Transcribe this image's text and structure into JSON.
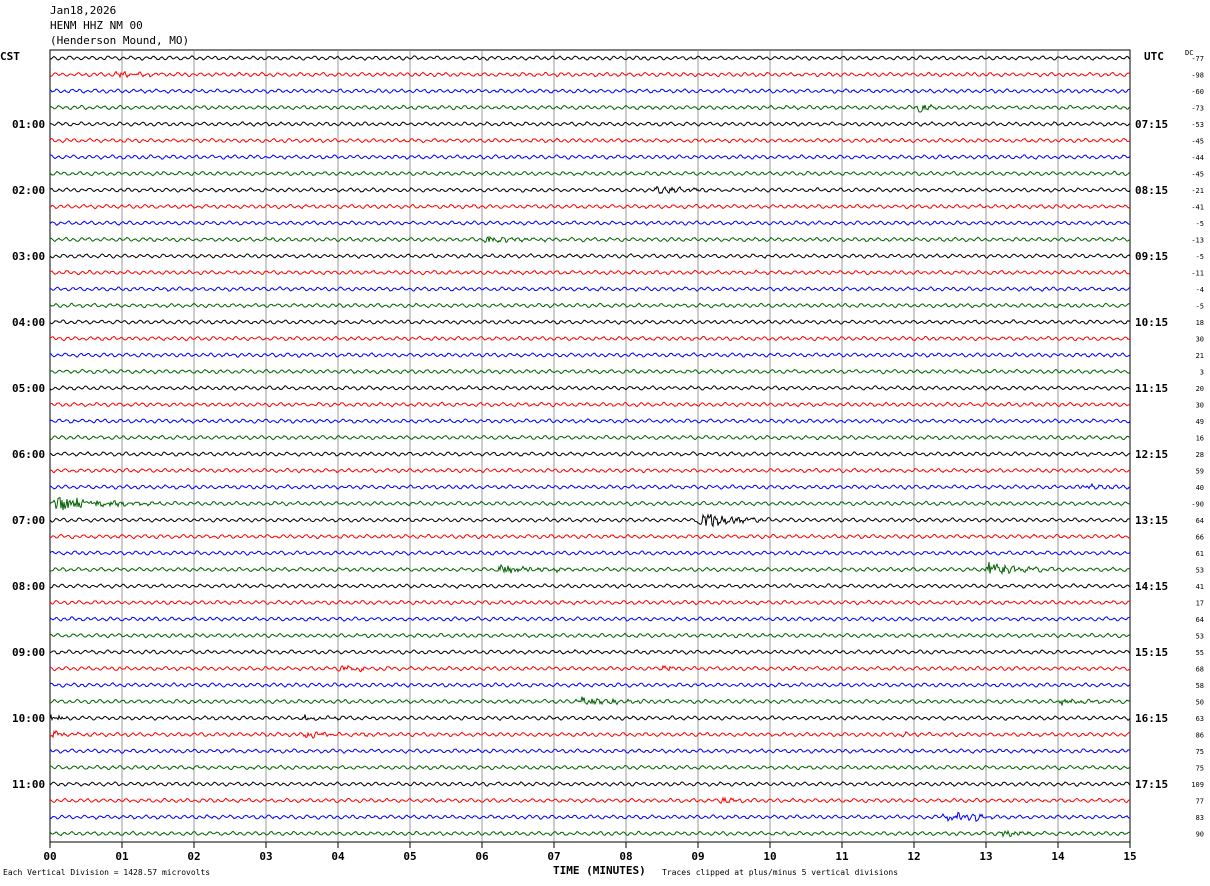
{
  "header": {
    "date": "Jan18,2026",
    "station": "HENM HHZ NM 00",
    "location": "(Henderson Mound, MO)"
  },
  "axes": {
    "left_label": "CST",
    "right_label": "UTC",
    "dc_label": "DC",
    "xlabel": "TIME (MINUTES)"
  },
  "footer": {
    "scale_note": "Each Vertical Division = 1428.57 microvolts",
    "clip_note": "Traces clipped at plus/minus 5 vertical divisions"
  },
  "colors": {
    "black": "#000000",
    "red": "#ff0000",
    "blue": "#0000ff",
    "green": "#006400",
    "grid": "#808080"
  },
  "chart_data": {
    "type": "line",
    "title": "",
    "x_ticks": [
      "00",
      "01",
      "02",
      "03",
      "04",
      "05",
      "06",
      "07",
      "08",
      "09",
      "10",
      "11",
      "12",
      "13",
      "14",
      "15"
    ],
    "xlim": [
      0,
      15
    ],
    "line_count": 48,
    "trace_color_cycle": [
      "black",
      "red",
      "blue",
      "green"
    ],
    "left_hour_labels": [
      {
        "line": 4,
        "label": "01:00"
      },
      {
        "line": 8,
        "label": "02:00"
      },
      {
        "line": 12,
        "label": "03:00"
      },
      {
        "line": 16,
        "label": "04:00"
      },
      {
        "line": 20,
        "label": "05:00"
      },
      {
        "line": 24,
        "label": "06:00"
      },
      {
        "line": 28,
        "label": "07:00"
      },
      {
        "line": 32,
        "label": "08:00"
      },
      {
        "line": 36,
        "label": "09:00"
      },
      {
        "line": 40,
        "label": "10:00"
      },
      {
        "line": 44,
        "label": "11:00"
      }
    ],
    "right_hour_labels": [
      {
        "line": 4,
        "label": "07:15"
      },
      {
        "line": 8,
        "label": "08:15"
      },
      {
        "line": 12,
        "label": "09:15"
      },
      {
        "line": 16,
        "label": "10:15"
      },
      {
        "line": 20,
        "label": "11:15"
      },
      {
        "line": 24,
        "label": "12:15"
      },
      {
        "line": 28,
        "label": "13:15"
      },
      {
        "line": 32,
        "label": "14:15"
      },
      {
        "line": 36,
        "label": "15:15"
      },
      {
        "line": 40,
        "label": "16:15"
      },
      {
        "line": 44,
        "label": "17:15"
      }
    ],
    "dc_offsets": [
      "-77",
      "-98",
      "-60",
      "-73",
      "-53",
      "-45",
      "-44",
      "-45",
      "-21",
      "-41",
      "-5",
      "-13",
      "-5",
      "-11",
      "-4",
      "-5",
      "18",
      "30",
      "21",
      "3",
      "20",
      "30",
      "49",
      "16",
      "28",
      "59",
      "40",
      "-90",
      "64",
      "66",
      "61",
      "53",
      "41",
      "17",
      "64",
      "53",
      "55",
      "68",
      "58",
      "50",
      "63",
      "86",
      "75",
      "75",
      "109",
      "77",
      "83",
      "90"
    ],
    "events": [
      {
        "line": 1,
        "minute": 0.9,
        "duration": 1.0,
        "amplitude": 3
      },
      {
        "line": 3,
        "minute": 12.05,
        "duration": 0.4,
        "amplitude": 6
      },
      {
        "line": 8,
        "minute": 8.4,
        "duration": 1.1,
        "amplitude": 4
      },
      {
        "line": 11,
        "minute": 6.0,
        "duration": 1.2,
        "amplitude": 4
      },
      {
        "line": 26,
        "minute": 14.3,
        "duration": 0.7,
        "amplitude": 4
      },
      {
        "line": 27,
        "minute": 0.05,
        "duration": 1.5,
        "amplitude": 9
      },
      {
        "line": 28,
        "minute": 9.0,
        "duration": 1.0,
        "amplitude": 13
      },
      {
        "line": 31,
        "minute": 6.2,
        "duration": 1.2,
        "amplitude": 5
      },
      {
        "line": 31,
        "minute": 13.0,
        "duration": 1.0,
        "amplitude": 9
      },
      {
        "line": 37,
        "minute": 4.0,
        "duration": 1.0,
        "amplitude": 4
      },
      {
        "line": 37,
        "minute": 8.5,
        "duration": 0.4,
        "amplitude": 4
      },
      {
        "line": 39,
        "minute": 7.3,
        "duration": 1.5,
        "amplitude": 4
      },
      {
        "line": 39,
        "minute": 14.0,
        "duration": 1.0,
        "amplitude": 3
      },
      {
        "line": 40,
        "minute": 0.0,
        "duration": 0.7,
        "amplitude": 4
      },
      {
        "line": 40,
        "minute": 3.5,
        "duration": 1.0,
        "amplitude": 3
      },
      {
        "line": 41,
        "minute": 0.0,
        "duration": 0.6,
        "amplitude": 4
      },
      {
        "line": 41,
        "minute": 3.5,
        "duration": 1.5,
        "amplitude": 3
      },
      {
        "line": 41,
        "minute": 11.8,
        "duration": 0.5,
        "amplitude": 3
      },
      {
        "line": 45,
        "minute": 9.3,
        "duration": 0.5,
        "amplitude": 3
      },
      {
        "line": 46,
        "minute": 12.4,
        "duration": 1.0,
        "amplitude": 5
      },
      {
        "line": 46,
        "minute": 12.85,
        "duration": 0.15,
        "amplitude": 10
      },
      {
        "line": 47,
        "minute": 13.2,
        "duration": 1.0,
        "amplitude": 3
      }
    ]
  }
}
